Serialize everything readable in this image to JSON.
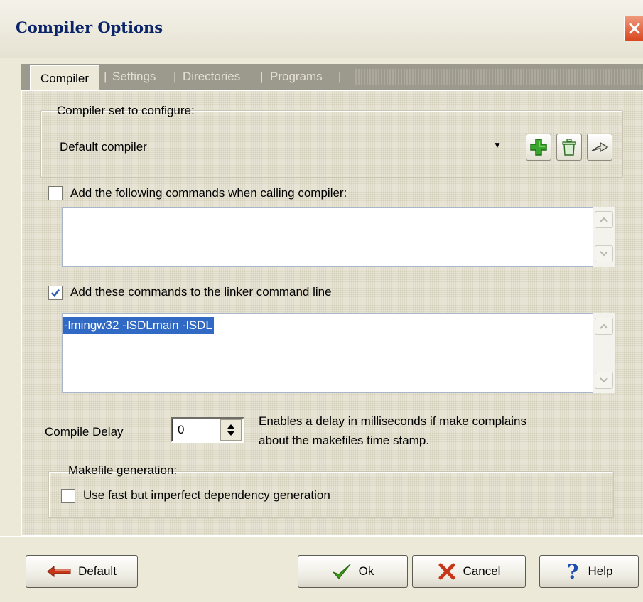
{
  "window": {
    "title": "Compiler Options"
  },
  "tabs": [
    {
      "label": "Compiler",
      "active": true
    },
    {
      "label": "Settings",
      "active": false
    },
    {
      "label": "Directories",
      "active": false
    },
    {
      "label": "Programs",
      "active": false
    }
  ],
  "compiler_set": {
    "label": "Compiler set to configure:",
    "selected": "Default compiler",
    "buttons": [
      "add-icon",
      "delete-icon",
      "rename-icon"
    ]
  },
  "compiler_commands": {
    "label": "Add the following commands when calling compiler:",
    "checked": false,
    "value": ""
  },
  "linker_commands": {
    "label": "Add these commands to the linker command line",
    "checked": true,
    "value": "-lmingw32 -lSDLmain -lSDL"
  },
  "compile_delay": {
    "label": "Compile Delay",
    "value": "0",
    "hint_line1": "Enables a delay in milliseconds if make complains",
    "hint_line2": "about the makefiles time stamp."
  },
  "makefile": {
    "group_label": "Makefile generation:",
    "option_label": "Use fast but imperfect dependency generation",
    "checked": false
  },
  "buttons": {
    "default_underline": "D",
    "default_rest": "efault",
    "ok_underline": "O",
    "ok_rest": "k",
    "cancel_underline": "C",
    "cancel_rest": "ancel",
    "help_underline": "H",
    "help_rest": "elp"
  },
  "colors": {
    "title": "#0A246A",
    "selection": "#316AC5",
    "check": "#2B5FB0",
    "ok_icon": "#3D9A1B",
    "cancel_icon": "#C8361A",
    "help_icon": "#1E4FB0",
    "add_icon": "#3AA62E"
  }
}
